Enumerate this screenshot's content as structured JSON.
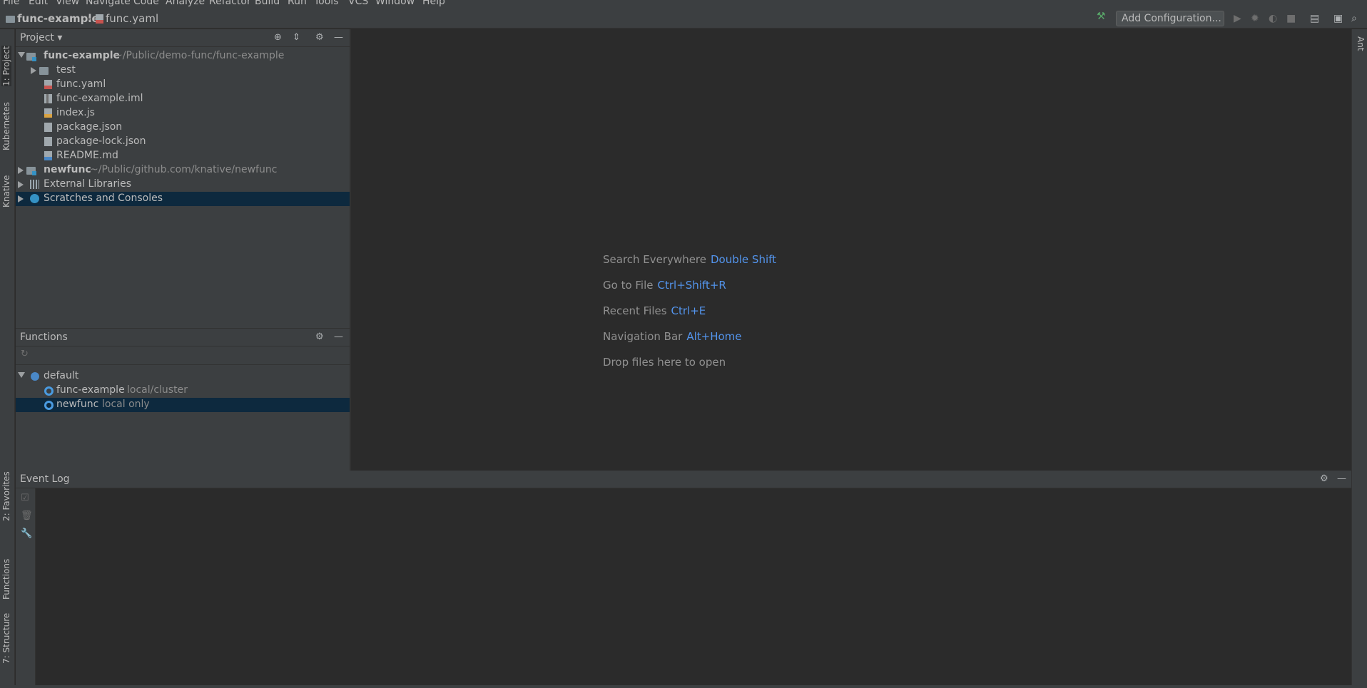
{
  "menu": [
    "File",
    "Edit",
    "View",
    "Navigate",
    "Code",
    "Analyze",
    "Refactor",
    "Build",
    "Run",
    "Tools",
    "VCS",
    "Window",
    "Help"
  ],
  "breadcrumb": {
    "project": "func-example",
    "file": "func.yaml"
  },
  "toolbar": {
    "add_configuration": "Add Configuration..."
  },
  "left_tabs": {
    "project": "1: Project",
    "kubernetes": "Kubernetes",
    "knative": "Knative",
    "favorites": "2: Favorites",
    "functions": "Functions",
    "structure": "7: Structure"
  },
  "right_tabs": {
    "ant": "Ant"
  },
  "project_panel": {
    "title": "Project",
    "tree": [
      {
        "label": "func-example",
        "hint": "~/Public/demo-func/func-example"
      },
      {
        "label": "test"
      },
      {
        "label": "func.yaml"
      },
      {
        "label": "func-example.iml"
      },
      {
        "label": "index.js"
      },
      {
        "label": "package.json"
      },
      {
        "label": "package-lock.json"
      },
      {
        "label": "README.md"
      },
      {
        "label": "newfunc",
        "hint": "~/Public/github.com/knative/newfunc"
      },
      {
        "label": "External Libraries"
      },
      {
        "label": "Scratches and Consoles"
      }
    ]
  },
  "functions_panel": {
    "title": "Functions",
    "tree": [
      {
        "label": "default"
      },
      {
        "label": "func-example",
        "hint": "local/cluster"
      },
      {
        "label": "newfunc",
        "hint": "local only"
      }
    ]
  },
  "editor_tips": [
    {
      "label": "Search Everywhere",
      "shortcut": "Double Shift"
    },
    {
      "label": "Go to File",
      "shortcut": "Ctrl+Shift+R"
    },
    {
      "label": "Recent Files",
      "shortcut": "Ctrl+E"
    },
    {
      "label": "Navigation Bar",
      "shortcut": "Alt+Home"
    },
    {
      "label": "Drop files here to open",
      "shortcut": ""
    }
  ],
  "event_log": {
    "title": "Event Log"
  },
  "colors": {
    "panel_bg": "#3c3f41",
    "editor_bg": "#2b2b2b",
    "selection": "#0d293e",
    "link": "#5394ec"
  }
}
